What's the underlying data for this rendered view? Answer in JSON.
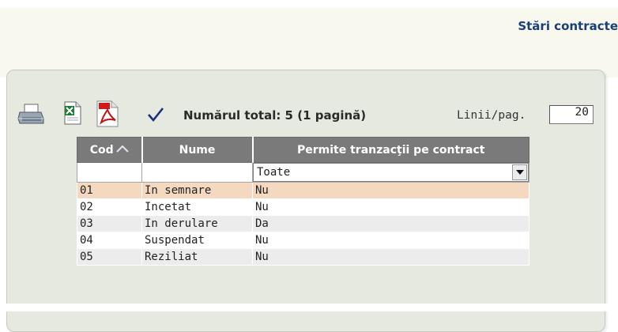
{
  "header": {
    "title": "Stări contracte"
  },
  "toolbar": {
    "icons": [
      "printer-icon",
      "excel-icon",
      "pdf-icon",
      "check-icon"
    ],
    "total_text": "Numărul total: 5 (1 pagină)",
    "lines_label": "Linii/pag.",
    "lines_value": "20"
  },
  "grid": {
    "columns": [
      "Cod",
      "Nume",
      "Permite tranzacţii pe contract"
    ],
    "sort_column": "Cod",
    "filter": {
      "selected": "Toate"
    },
    "rows": [
      {
        "cod": "01",
        "nume": "In semnare",
        "permite": "Nu"
      },
      {
        "cod": "02",
        "nume": "Incetat",
        "permite": "Nu"
      },
      {
        "cod": "03",
        "nume": "In derulare",
        "permite": "Da"
      },
      {
        "cod": "04",
        "nume": "Suspendat",
        "permite": "Nu"
      },
      {
        "cod": "05",
        "nume": "Reziliat",
        "permite": "Nu"
      }
    ],
    "selected_row_index": 0
  },
  "colors": {
    "title": "#1a3f78",
    "header_bg": "#7a7a7a",
    "selected_row": "#f4d8bf",
    "alt_row": "#ececec",
    "panel_bg": "#e6e9df"
  }
}
